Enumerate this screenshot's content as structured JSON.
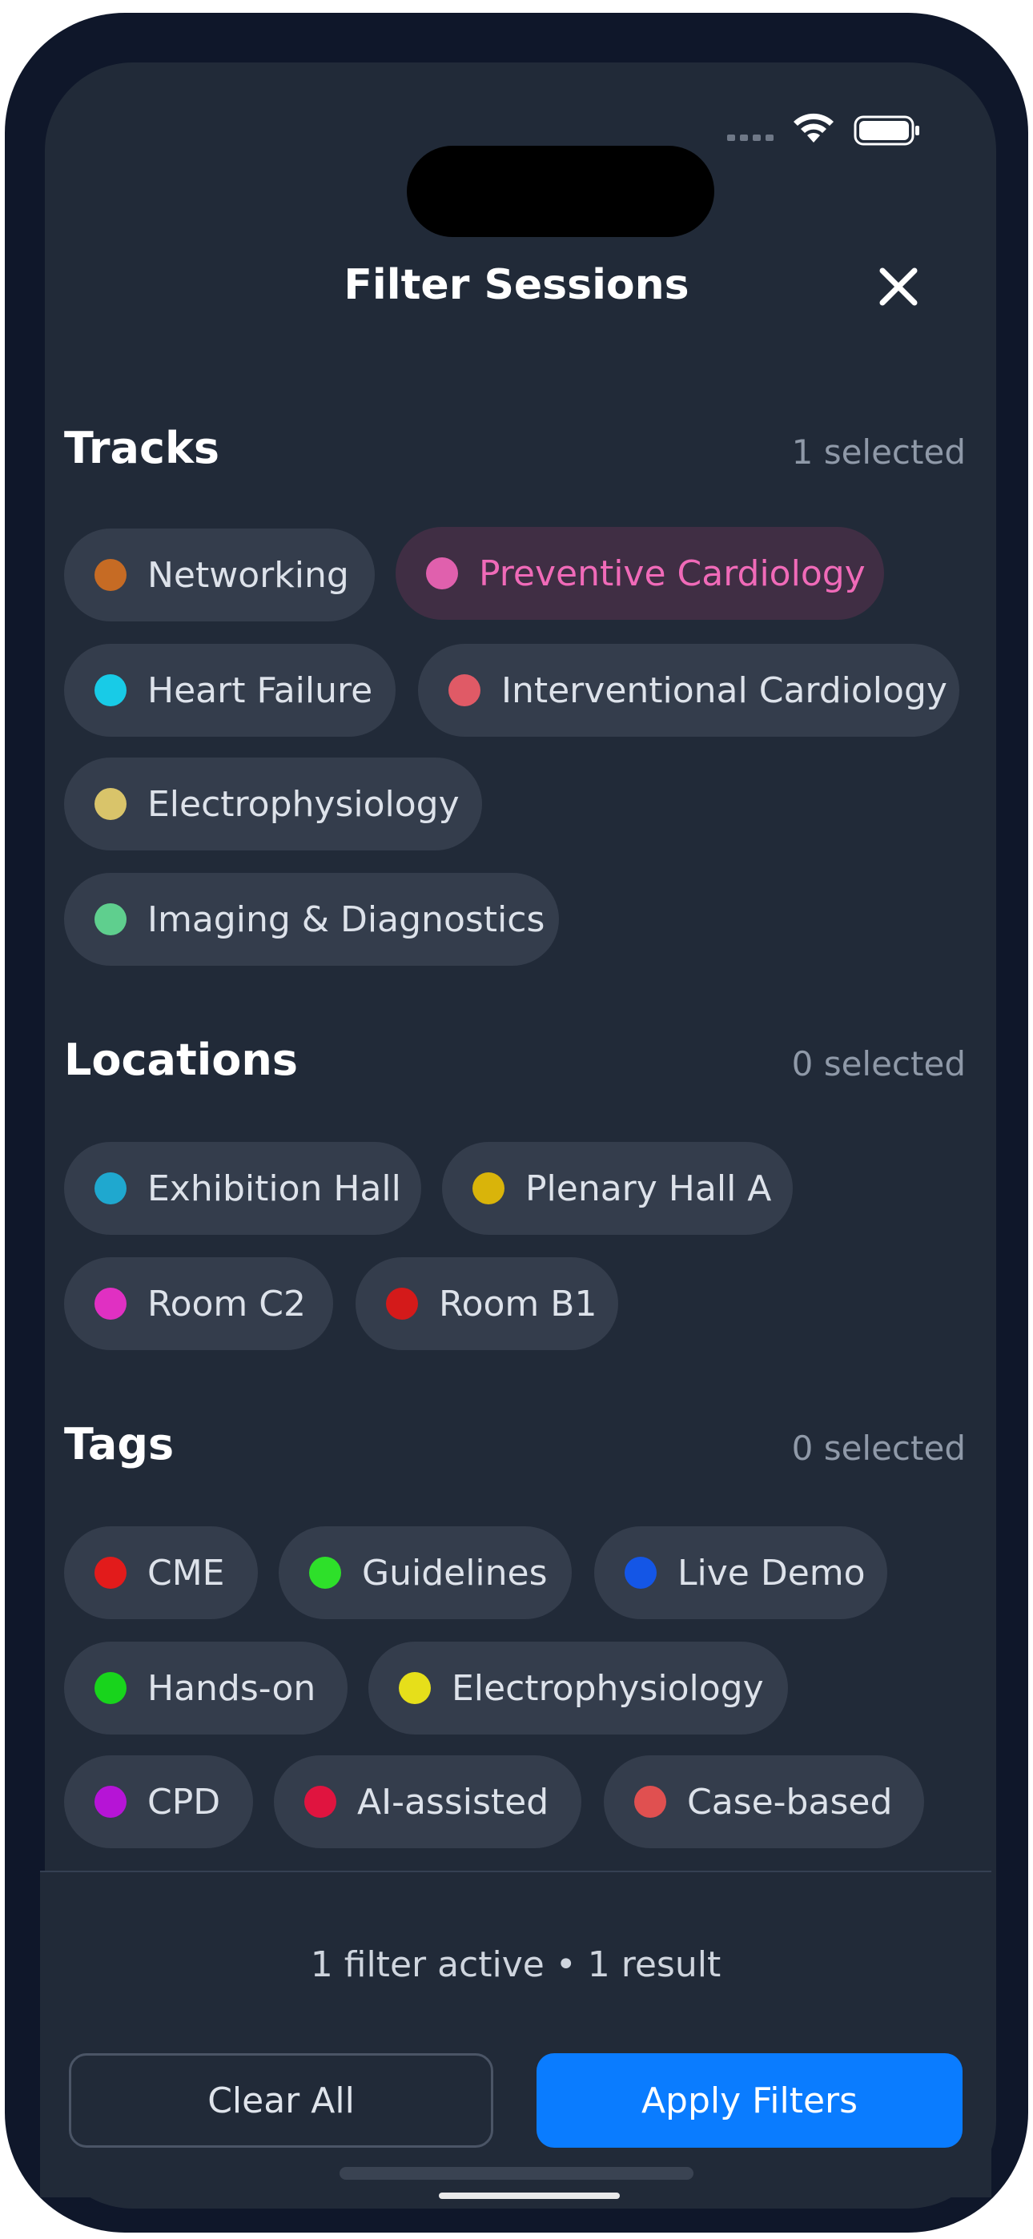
{
  "header": {
    "title": "Filter Sessions"
  },
  "sections": {
    "tracks": {
      "title": "Tracks",
      "count": "1 selected",
      "chips": [
        {
          "label": "Networking",
          "color": "#c66b24",
          "selected": false
        },
        {
          "label": "Preventive Cardiology",
          "color": "#e060ad",
          "selected": true
        },
        {
          "label": "Heart Failure",
          "color": "#18cbe7",
          "selected": false
        },
        {
          "label": "Interventional Cardiology",
          "color": "#e05a66",
          "selected": false
        },
        {
          "label": "Electrophysiology",
          "color": "#d9c46a",
          "selected": false
        },
        {
          "label": "Imaging & Diagnostics",
          "color": "#5fcf8e",
          "selected": false
        }
      ]
    },
    "locations": {
      "title": "Locations",
      "count": "0 selected",
      "chips": [
        {
          "label": "Exhibition Hall",
          "color": "#1fa8cf",
          "selected": false
        },
        {
          "label": "Plenary Hall A",
          "color": "#d9b40a",
          "selected": false
        },
        {
          "label": "Room C2",
          "color": "#e030c2",
          "selected": false
        },
        {
          "label": "Room B1",
          "color": "#d41a1a",
          "selected": false
        }
      ]
    },
    "tags": {
      "title": "Tags",
      "count": "0 selected",
      "chips": [
        {
          "label": "CME",
          "color": "#e21b1b",
          "selected": false
        },
        {
          "label": "Guidelines",
          "color": "#2ee02a",
          "selected": false
        },
        {
          "label": "Live Demo",
          "color": "#1456e6",
          "selected": false
        },
        {
          "label": "Hands-on",
          "color": "#18d41c",
          "selected": false
        },
        {
          "label": "Electrophysiology",
          "color": "#e6df1a",
          "selected": false
        },
        {
          "label": "CPD",
          "color": "#b614d6",
          "selected": false
        },
        {
          "label": "AI-assisted",
          "color": "#e0143f",
          "selected": false
        },
        {
          "label": "Case-based",
          "color": "#e05050",
          "selected": false
        }
      ]
    }
  },
  "footer": {
    "status": "1 filter active • 1 result",
    "clear_label": "Clear All",
    "apply_label": "Apply Filters"
  },
  "icons": {
    "close": "close-icon",
    "wifi": "wifi-icon",
    "battery": "battery-icon",
    "signal": "signal-icon"
  },
  "colors": {
    "background": "#212a38",
    "chip": "#343d4c",
    "selected_chip": "#402e44",
    "accent": "#0a7cff"
  }
}
